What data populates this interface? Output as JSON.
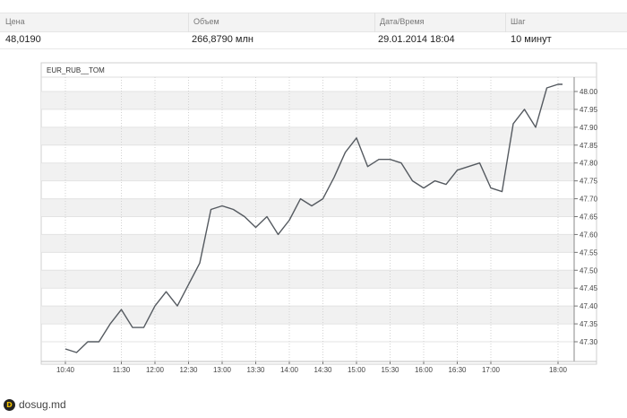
{
  "info": {
    "headers": [
      "Цена",
      "Объем",
      "Дата/Время",
      "Шаг"
    ],
    "values": [
      "48,0190",
      "266,8790 млн",
      "29.01.2014 18:04",
      "10 минут"
    ]
  },
  "chart_data": {
    "type": "line",
    "title": "EUR_RUB__TOM",
    "x_ticks": [
      "10:40",
      "11:30",
      "12:00",
      "12:30",
      "13:00",
      "13:30",
      "14:00",
      "14:30",
      "15:00",
      "15:30",
      "16:00",
      "16:30",
      "17:00",
      "18:00"
    ],
    "y_ticks": [
      "48.00",
      "47.95",
      "47.90",
      "47.85",
      "47.80",
      "47.75",
      "47.70",
      "47.65",
      "47.60",
      "47.55",
      "47.50",
      "47.45",
      "47.40",
      "47.35",
      "47.30"
    ],
    "ylim": [
      47.26,
      48.02
    ],
    "grid": true,
    "x": [
      "10:40",
      "10:50",
      "11:00",
      "11:10",
      "11:20",
      "11:30",
      "11:40",
      "11:50",
      "12:00",
      "12:10",
      "12:20",
      "12:30",
      "12:40",
      "12:50",
      "13:00",
      "13:10",
      "13:20",
      "13:30",
      "13:40",
      "13:50",
      "14:00",
      "14:10",
      "14:20",
      "14:30",
      "14:40",
      "14:50",
      "15:00",
      "15:10",
      "15:20",
      "15:30",
      "15:40",
      "15:50",
      "16:00",
      "16:10",
      "16:20",
      "16:30",
      "16:40",
      "16:50",
      "17:00",
      "17:10",
      "17:20",
      "17:30",
      "17:40",
      "17:50",
      "18:00",
      "18:04"
    ],
    "values": [
      47.28,
      47.27,
      47.3,
      47.3,
      47.35,
      47.39,
      47.34,
      47.34,
      47.4,
      47.44,
      47.4,
      47.46,
      47.52,
      47.67,
      47.68,
      47.67,
      47.65,
      47.62,
      47.65,
      47.6,
      47.64,
      47.7,
      47.68,
      47.7,
      47.76,
      47.83,
      47.87,
      47.79,
      47.81,
      47.81,
      47.8,
      47.75,
      47.73,
      47.75,
      47.74,
      47.78,
      47.79,
      47.8,
      47.73,
      47.72,
      47.91,
      47.95,
      47.9,
      48.01,
      48.02,
      48.02
    ]
  },
  "watermark": "dosug.md",
  "watermark_icon": "dosug-logo-icon"
}
